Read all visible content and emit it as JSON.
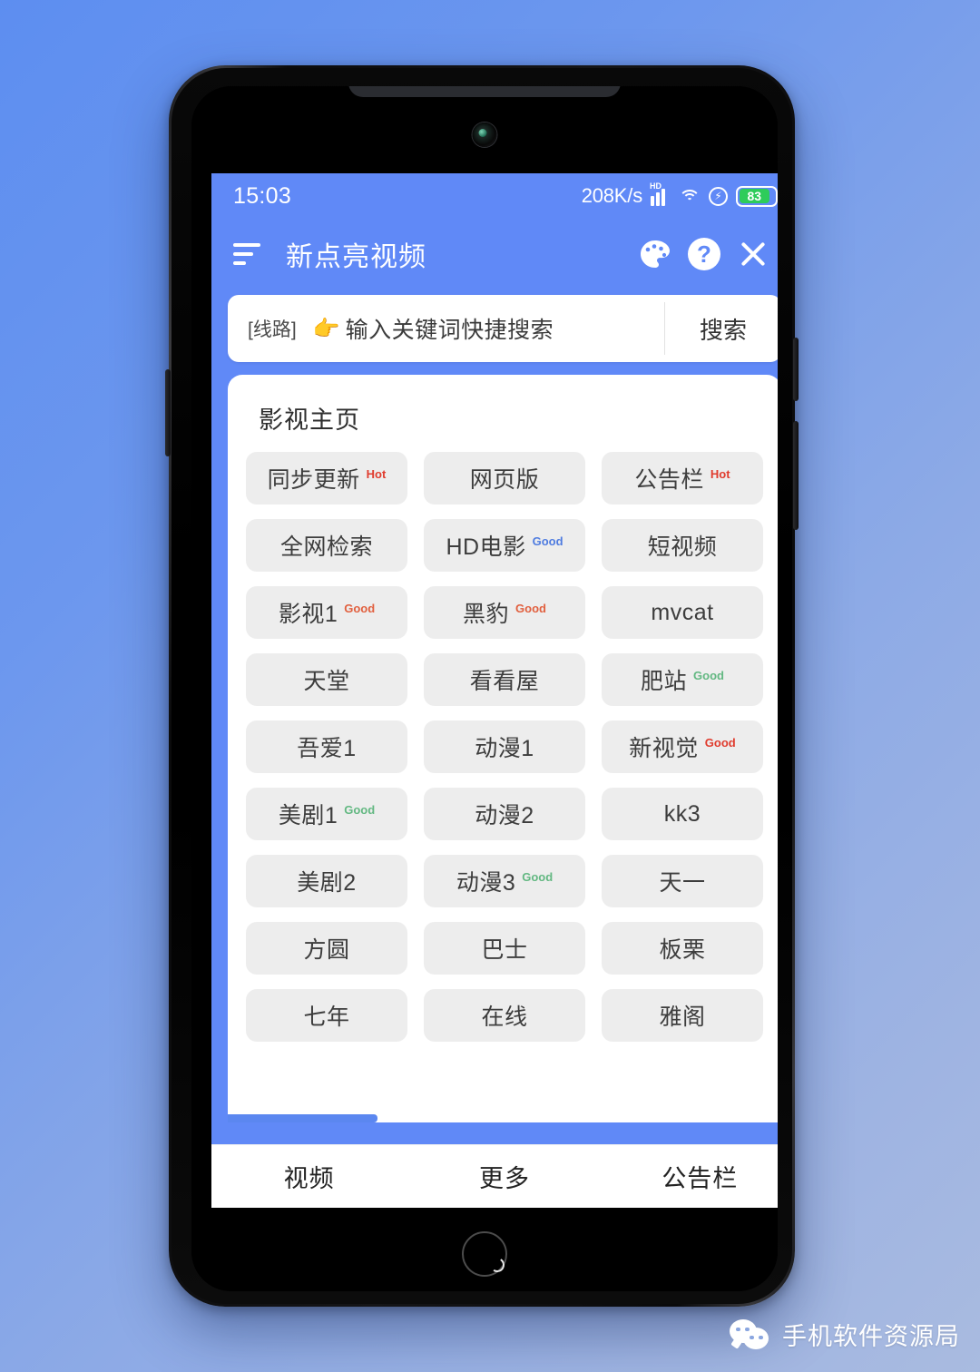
{
  "statusbar": {
    "time": "15:03",
    "net_speed": "208K/s",
    "hd_label": "HD",
    "battery_level": "83",
    "icons": [
      "signal-icon",
      "wifi-icon",
      "fast-charge-icon",
      "battery-icon"
    ]
  },
  "appbar": {
    "title": "新点亮视频",
    "menu_icon": "menu-icon",
    "palette_icon": "palette-icon",
    "help_icon": "help-icon",
    "close_icon": "close-icon"
  },
  "search": {
    "route_tag": "[线路]",
    "hand_emoji": "👉",
    "placeholder": "输入关键词快捷搜索",
    "button_label": "搜索"
  },
  "card": {
    "title": "影视主页",
    "scroll_progress": 27
  },
  "colors": {
    "accent": "#6089f7",
    "hot": "#e03c2e",
    "good_blue": "#4f7ce0",
    "good_red": "#e1603f",
    "good_green": "#63b882",
    "tile_bg": "#ededed"
  },
  "tiles": [
    {
      "label": "同步更新",
      "badge": "Hot",
      "badge_color": "#e03c2e"
    },
    {
      "label": "网页版",
      "badge": "",
      "badge_color": ""
    },
    {
      "label": "公告栏",
      "badge": "Hot",
      "badge_color": "#e03c2e"
    },
    {
      "label": "全网检索",
      "badge": "",
      "badge_color": ""
    },
    {
      "label": "HD电影",
      "badge": "Good",
      "badge_color": "#4f7ce0"
    },
    {
      "label": "短视频",
      "badge": "",
      "badge_color": ""
    },
    {
      "label": "影视1",
      "badge": "Good",
      "badge_color": "#e1603f"
    },
    {
      "label": "黑豹",
      "badge": "Good",
      "badge_color": "#e1603f"
    },
    {
      "label": "mvcat",
      "badge": "",
      "badge_color": ""
    },
    {
      "label": "天堂",
      "badge": "",
      "badge_color": ""
    },
    {
      "label": "看看屋",
      "badge": "",
      "badge_color": ""
    },
    {
      "label": "肥站",
      "badge": "Good",
      "badge_color": "#63b882"
    },
    {
      "label": "吾爱1",
      "badge": "",
      "badge_color": ""
    },
    {
      "label": "动漫1",
      "badge": "",
      "badge_color": ""
    },
    {
      "label": "新视觉",
      "badge": "Good",
      "badge_color": "#e03c2e"
    },
    {
      "label": "美剧1",
      "badge": "Good",
      "badge_color": "#63b882"
    },
    {
      "label": "动漫2",
      "badge": "",
      "badge_color": ""
    },
    {
      "label": "kk3",
      "badge": "",
      "badge_color": ""
    },
    {
      "label": "美剧2",
      "badge": "",
      "badge_color": ""
    },
    {
      "label": "动漫3",
      "badge": "Good",
      "badge_color": "#63b882"
    },
    {
      "label": "天一",
      "badge": "",
      "badge_color": ""
    },
    {
      "label": "方圆",
      "badge": "",
      "badge_color": ""
    },
    {
      "label": "巴士",
      "badge": "",
      "badge_color": ""
    },
    {
      "label": "板栗",
      "badge": "",
      "badge_color": ""
    },
    {
      "label": "七年",
      "badge": "",
      "badge_color": ""
    },
    {
      "label": "在线",
      "badge": "",
      "badge_color": ""
    },
    {
      "label": "雅阁",
      "badge": "",
      "badge_color": ""
    }
  ],
  "tabs": [
    {
      "label": "视频"
    },
    {
      "label": "更多"
    },
    {
      "label": "公告栏"
    }
  ],
  "watermark": {
    "text": "手机软件资源局",
    "icon": "wechat-icon"
  }
}
